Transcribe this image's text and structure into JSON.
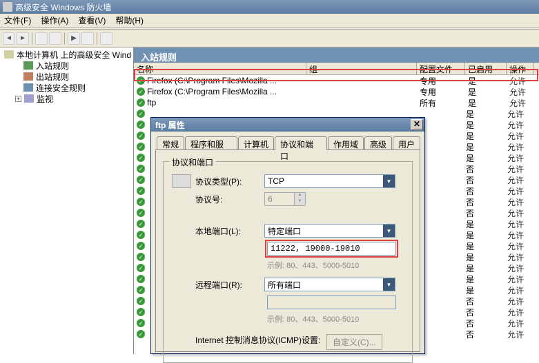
{
  "window": {
    "title": "高级安全 Windows 防火墙"
  },
  "menu": {
    "file": "文件(F)",
    "action": "操作(A)",
    "view": "查看(V)",
    "help": "帮助(H)"
  },
  "tree": {
    "root": "本地计算机 上的高级安全 Wind",
    "inbound": "入站规则",
    "outbound": "出站规则",
    "connsec": "连接安全规则",
    "monitor": "监视"
  },
  "list": {
    "title": "入站规则",
    "columns": {
      "name": "名称",
      "group": "组",
      "profile": "配置文件",
      "enabled": "已启用",
      "action": "操作"
    },
    "rows": [
      {
        "name": "Firefox (C:\\Program Files\\Mozilla ...",
        "group": "",
        "profile": "专用",
        "enabled": "是",
        "action": "允许"
      },
      {
        "name": "Firefox (C:\\Program Files\\Mozilla ...",
        "group": "",
        "profile": "专用",
        "enabled": "是",
        "action": "允许"
      },
      {
        "name": "ftp",
        "group": "",
        "profile": "所有",
        "enabled": "是",
        "action": "允许"
      }
    ],
    "side_rows": [
      {
        "profile": "",
        "enabled": "是",
        "action": "允许"
      },
      {
        "profile": "",
        "enabled": "是",
        "action": "允许"
      },
      {
        "profile": "",
        "enabled": "是",
        "action": "允许"
      },
      {
        "profile": "",
        "enabled": "是",
        "action": "允许"
      },
      {
        "profile": "",
        "enabled": "是",
        "action": "允许"
      },
      {
        "profile": "",
        "enabled": "否",
        "action": "允许"
      },
      {
        "profile": "",
        "enabled": "否",
        "action": "允许"
      },
      {
        "profile": "",
        "enabled": "否",
        "action": "允许"
      },
      {
        "profile": "",
        "enabled": "否",
        "action": "允许"
      },
      {
        "profile": "",
        "enabled": "否",
        "action": "允许"
      },
      {
        "profile": "",
        "enabled": "是",
        "action": "允许"
      },
      {
        "profile": "",
        "enabled": "是",
        "action": "允许"
      },
      {
        "profile": "",
        "enabled": "是",
        "action": "允许"
      },
      {
        "profile": "",
        "enabled": "是",
        "action": "允许"
      },
      {
        "profile": "",
        "enabled": "是",
        "action": "允许"
      },
      {
        "profile": "",
        "enabled": "是",
        "action": "允许"
      },
      {
        "profile": "",
        "enabled": "是",
        "action": "允许"
      },
      {
        "profile": "",
        "enabled": "否",
        "action": "允许"
      },
      {
        "profile": "",
        "enabled": "否",
        "action": "允许"
      },
      {
        "profile": "",
        "enabled": "否",
        "action": "允许"
      },
      {
        "profile": "",
        "enabled": "否",
        "action": "允许"
      }
    ]
  },
  "dialog": {
    "title": "ftp 属性",
    "tabs": {
      "general": "常规",
      "programs": "程序和服务",
      "computers": "计算机",
      "protocols": "协议和端口",
      "scope": "作用域",
      "advanced": "高级",
      "users": "用户"
    },
    "group_label": "协议和端口",
    "protocol_type_label": "协议类型(P):",
    "protocol_type_value": "TCP",
    "protocol_number_label": "协议号:",
    "protocol_number_value": "6",
    "local_port_label": "本地端口(L):",
    "local_port_type": "特定端口",
    "local_port_value": "11222, 19000-19010",
    "example1": "示例: 80、443、5000-5010",
    "remote_port_label": "远程端口(R):",
    "remote_port_type": "所有端口",
    "example2": "示例: 80、443、5000-5010",
    "icmp_label": "Internet 控制消息协议(ICMP)设置:",
    "customize_btn": "自定义(C)..."
  }
}
